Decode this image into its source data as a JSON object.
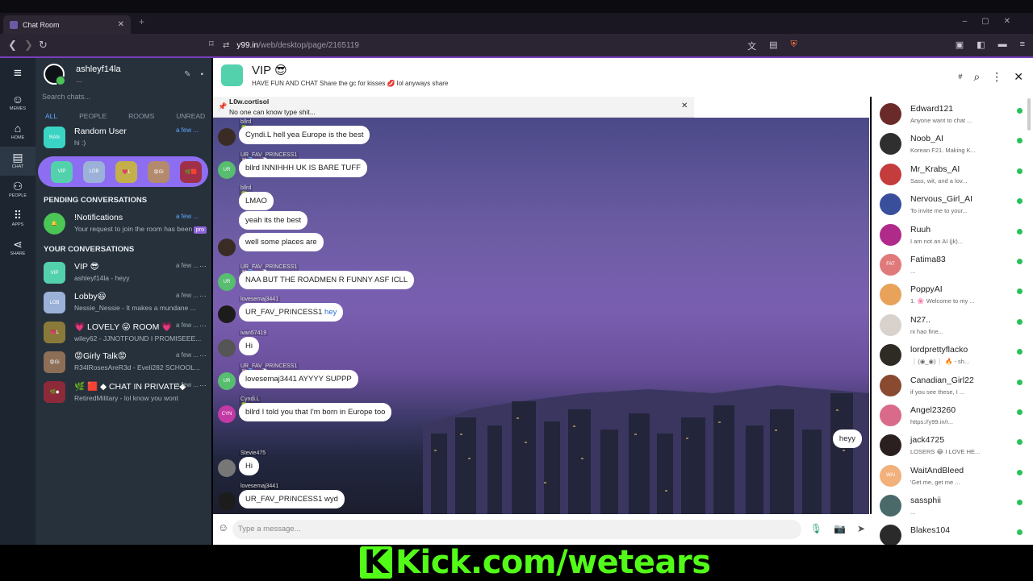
{
  "browser": {
    "tab_title": "Chat Room",
    "url_host": "y99.in",
    "url_path": "/web/desktop/page/2165119"
  },
  "rail": [
    {
      "label": "MEMES",
      "icon": "memes-icon"
    },
    {
      "label": "HOME",
      "icon": "home-icon"
    },
    {
      "label": "CHAT",
      "icon": "chat-icon"
    },
    {
      "label": "PEOPLE",
      "icon": "people-icon"
    },
    {
      "label": "APPS",
      "icon": "apps-icon"
    },
    {
      "label": "SHARE",
      "icon": "share-icon"
    }
  ],
  "sidebar": {
    "username": "ashleyf14la",
    "status": "...",
    "search_placeholder": "Search chats...",
    "filters": [
      "ALL",
      "PEOPLE",
      "ROOMS",
      "UNREAD"
    ],
    "pinned": {
      "name": "Random User",
      "preview": "hi :)",
      "time": "a few ...",
      "avatar": "RAN"
    },
    "pill_avatars": [
      "VIP",
      "LOB",
      "💗L",
      "😡Gi",
      "🌿🟥"
    ],
    "pending_title": "PENDING CONVERSATIONS",
    "pending": {
      "name": "!Notifications",
      "preview": "Your request to join the room has been",
      "time": "a few ...",
      "badge": "pro"
    },
    "yours_title": "YOUR CONVERSATIONS",
    "conversations": [
      {
        "name": "VIP 😎",
        "preview": "ashleyf14la - heyy",
        "time": "a few ...",
        "avatar": "VIP",
        "color": "#53d1ad"
      },
      {
        "name": "Lobby😃",
        "preview": "Nessie_Nessie - It makes a mundane ...",
        "time": "a few ...",
        "avatar": "LOB",
        "color": "#9bb1d8"
      },
      {
        "name": "💗 LOVELY 😜 ROOM 💗",
        "preview": "wiley62 - JJNOTFOUND I PROMISEEE...",
        "time": "a few ...",
        "avatar": "💗L",
        "color": "#8a7a3a"
      },
      {
        "name": "😡Girly Talk😡",
        "preview": "R34lRosesAreR3d - Eveli282 SCHOOL...",
        "time": "a few ...",
        "avatar": "😡Gi",
        "color": "#8d6f58"
      },
      {
        "name": "🌿 🟥 ◆ CHAT IN PRIVATE◆",
        "preview": "RetiredMilitary - lol know you wont",
        "time": "a few ...",
        "avatar": "🌿◆",
        "color": "#8c2a3a"
      }
    ]
  },
  "room": {
    "title": "VIP 😎",
    "description": "HAVE FUN AND CHAT Share the gc for kisses 💋 lol anyways share",
    "pinned_user": "L0w.cortisol",
    "pinned_text": "No one can know type shit...",
    "composer_placeholder": "Type a message..."
  },
  "messages": [
    {
      "user": "bllrd 🍀",
      "text": "Cyndi.L hell yea Europe is the best",
      "avatar": "",
      "color": "#3a2c25"
    },
    {
      "user": "UR_FAV_PRINCESS1 🐰🌀💗👻🐨",
      "text": "bllrd INNIHHH UK IS BARE TUFF",
      "avatar": "UR",
      "color": "#57bd6f"
    },
    {
      "user": "bllrd 🍀",
      "text": "LMAO",
      "avatar": "",
      "color": ""
    },
    {
      "user": "",
      "text": "yeah its the best",
      "avatar": "",
      "color": ""
    },
    {
      "user": "",
      "text": "well some places are",
      "avatar": "",
      "color": "#3a2c25"
    },
    {
      "user": "UR_FAV_PRINCESS1 🐰🌀💗👻🐨",
      "text": "NAA BUT THE ROADMEN R FUNNY ASF ICLL",
      "avatar": "UR",
      "color": "#57bd6f"
    },
    {
      "user": "lovesemaj3441",
      "text": "UR_FAV_PRINCESS1",
      "text_hl": "hey",
      "avatar": "",
      "color": "#1c1c1c"
    },
    {
      "user": "ivan57419",
      "text": "Hi",
      "avatar": "",
      "color": "#555"
    },
    {
      "user": "UR_FAV_PRINCESS1 🐰🌀💗👻🐨",
      "text": "lovesemaj3441 AYYYY SUPPP",
      "avatar": "UR",
      "color": "#57bd6f"
    },
    {
      "user": "Cyndi.L 🍀",
      "text": "bllrd I told you that I'm born in Europe too",
      "avatar": "CYN",
      "color": "#c23aa4"
    },
    {
      "user": "Stevie475",
      "text": "Hi",
      "avatar": "",
      "color": "#777"
    },
    {
      "user": "lovesemaj3441",
      "text": "UR_FAV_PRINCESS1 wyd",
      "avatar": "",
      "color": "#1c1c1c"
    }
  ],
  "my_message": "heyy",
  "users": [
    {
      "name": "Edward121",
      "status": "Anyone want to chat ...",
      "avatar": "",
      "color": "#6b2a2a"
    },
    {
      "name": "Noob_AI",
      "status": "Korean F21. Making K...",
      "avatar": "",
      "color": "#2f2f2f"
    },
    {
      "name": "Mr_Krabs_AI",
      "status": "Sass, wit, and a lov...",
      "avatar": "",
      "color": "#c43c3c"
    },
    {
      "name": "Nervous_Girl_AI",
      "status": "To invite me to your...",
      "avatar": "",
      "color": "#3a4f9c"
    },
    {
      "name": "Ruuh",
      "status": "I am not an AI (jk)...",
      "avatar": "",
      "color": "#b02a8a"
    },
    {
      "name": "Fatima83",
      "status": "...",
      "avatar": "FAT",
      "color": "#e07a7a"
    },
    {
      "name": "PoppyAI",
      "status": "1. 🌸 Welcome to my ...",
      "avatar": "",
      "color": "#e8a25a"
    },
    {
      "name": "N27..",
      "status": "ni hao fine...",
      "avatar": "",
      "color": "#d9d2cc"
    },
    {
      "name": "lordprettyflacko",
      "status": "❕(◉_◉)❕ 🔥 - sh...",
      "avatar": "",
      "color": "#2e2a24"
    },
    {
      "name": "Canadian_Girl22",
      "status": "if you see these, I ...",
      "avatar": "",
      "color": "#8a4a30"
    },
    {
      "name": "Angel23260",
      "status": "https://y99.in/r...",
      "avatar": "",
      "color": "#d96a8a"
    },
    {
      "name": "jack4725",
      "status": "LOSERS 😂 I LOVE HE...",
      "avatar": "",
      "color": "#2a2020"
    },
    {
      "name": "WaitAndBleed",
      "status": "'Get me, get me ...",
      "avatar": "WAI",
      "color": "#f2b07a"
    },
    {
      "name": "sassphii",
      "status": "...",
      "avatar": "",
      "color": "#4a6a6a"
    },
    {
      "name": "Blakes104",
      "status": "",
      "avatar": "",
      "color": "#2a2a2a"
    }
  ],
  "overlay": {
    "text": "Kick.com/wetears",
    "logo": "K",
    "color": "#53fc18"
  }
}
